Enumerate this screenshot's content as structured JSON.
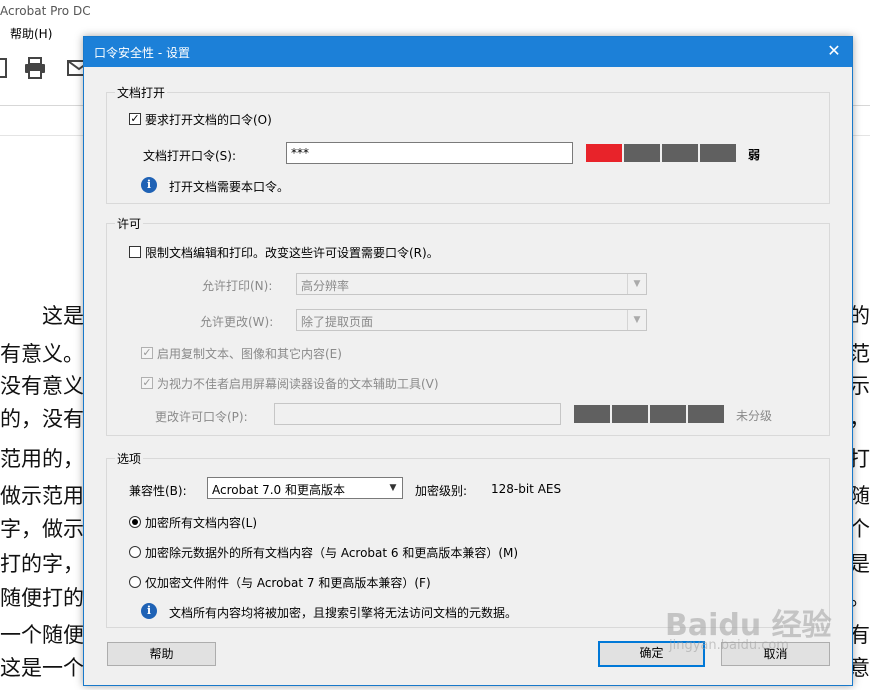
{
  "app": {
    "title": "Acrobat Pro DC",
    "menu_help": "帮助(H)"
  },
  "document": {
    "lines": [
      {
        "left": "　　这是",
        "right": "用的"
      },
      {
        "left": "有意义。",
        "right": "范"
      },
      {
        "left": "没有意义",
        "right": "做示"
      },
      {
        "left": "的，没有",
        "right": "字，"
      },
      {
        "left": "范用的，",
        "right": "打"
      },
      {
        "left": "做示范用",
        "right": "随"
      },
      {
        "left": "字，做示",
        "right": "一个"
      },
      {
        "left": "打的字，",
        "right": "这是"
      },
      {
        "left": "随便打的",
        "right": "义。"
      },
      {
        "left": "一个随便",
        "right": "有"
      },
      {
        "left": "这是一个",
        "right": "意"
      }
    ]
  },
  "dialog": {
    "title": "口令安全性 - 设置",
    "open": {
      "group_label": "文档打开",
      "require_label": "要求打开文档的口令(O)",
      "require_checked": true,
      "password_label": "文档打开口令(S):",
      "password_value": "***",
      "strength_text": "弱",
      "strength_level": 1,
      "strength_color": "#e8232a",
      "info_text": "打开文档需要本口令。"
    },
    "permissions": {
      "group_label": "许可",
      "restrict_label": "限制文档编辑和打印。改变这些许可设置需要口令(R)。",
      "restrict_checked": false,
      "print_label": "允许打印(N):",
      "print_value": "高分辨率",
      "change_label": "允许更改(W):",
      "change_value": "除了提取页面",
      "copy_label": "启用复制文本、图像和其它内容(E)",
      "copy_checked": true,
      "access_label": "为视力不佳者启用屏幕阅读器设备的文本辅助工具(V)",
      "access_checked": true,
      "perm_password_label": "更改许可口令(P):",
      "perm_password_value": "",
      "strength_text": "未分级"
    },
    "options": {
      "group_label": "选项",
      "compat_label": "兼容性(B):",
      "compat_value": "Acrobat 7.0 和更高版本",
      "encrypt_level_label": "加密级别:",
      "encrypt_level_value": "128-bit AES",
      "radio_all": "加密所有文档内容(L)",
      "radio_except_meta": "加密除元数据外的所有文档内容（与 Acrobat 6 和更高版本兼容）(M)",
      "radio_attachments": "仅加密文件附件（与 Acrobat 7 和更高版本兼容）(F)",
      "selected": "all",
      "info_text": "文档所有内容均将被加密，且搜索引擎将无法访问文档的元数据。"
    },
    "buttons": {
      "help": "帮助",
      "ok": "确定",
      "cancel": "取消"
    }
  },
  "watermark": {
    "text": "Baidu 经验",
    "sub": "jingyan.baidu.com"
  }
}
